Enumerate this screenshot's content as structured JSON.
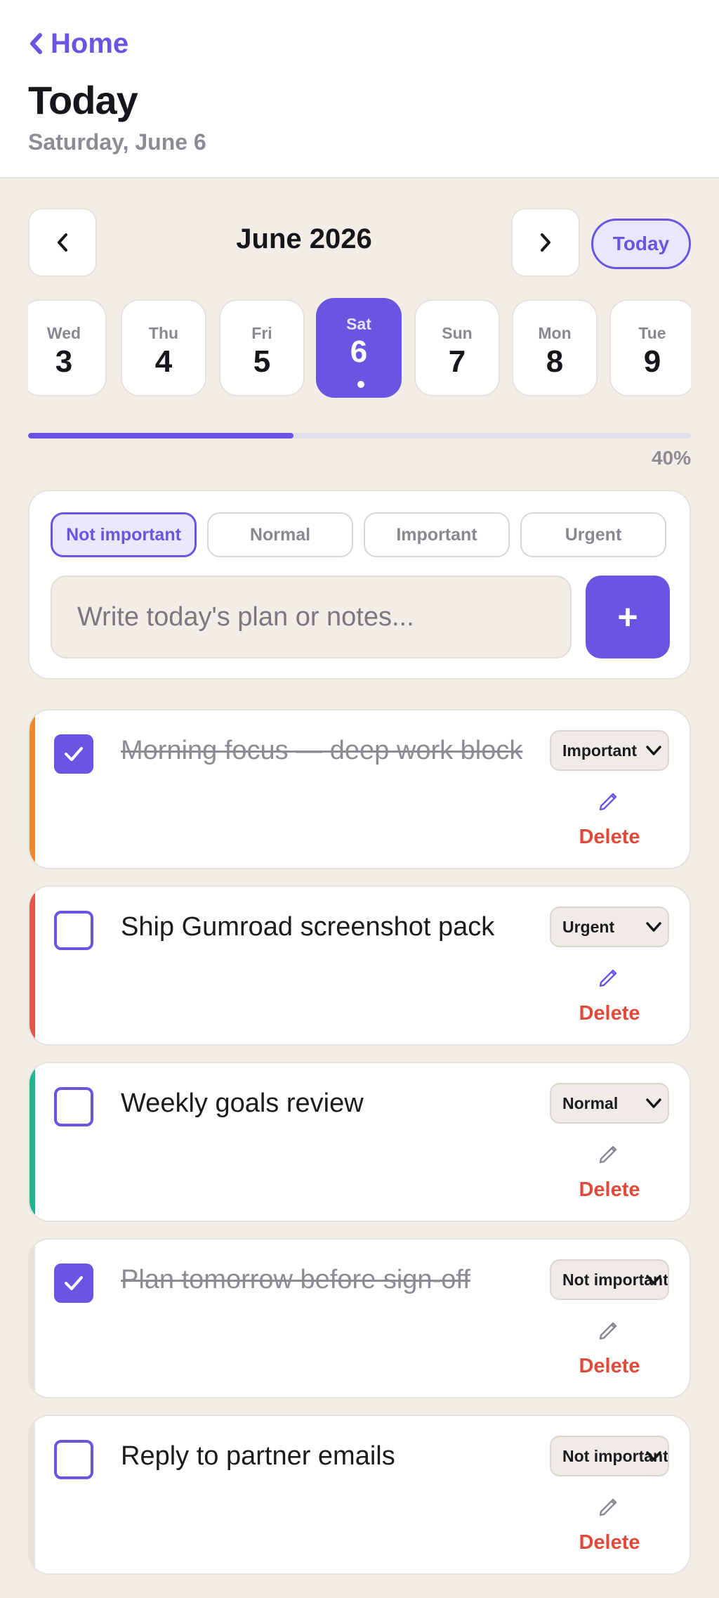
{
  "header": {
    "back_label": "Home",
    "title": "Today",
    "subtitle": "Saturday, June 6"
  },
  "calendar": {
    "month_label": "June 2026",
    "today_label": "Today",
    "prev_icon": "chevron-left-icon",
    "next_icon": "chevron-right-icon",
    "days": [
      {
        "dow": "Wed",
        "num": "3"
      },
      {
        "dow": "Thu",
        "num": "4"
      },
      {
        "dow": "Fri",
        "num": "5"
      },
      {
        "dow": "Sat",
        "num": "6",
        "selected": true,
        "has_dot": true
      },
      {
        "dow": "Sun",
        "num": "7"
      },
      {
        "dow": "Mon",
        "num": "8"
      },
      {
        "dow": "Tue",
        "num": "9"
      }
    ]
  },
  "progress": {
    "value": 0.4,
    "label": "40%"
  },
  "composer": {
    "priorities": [
      "Not important",
      "Normal",
      "Important",
      "Urgent"
    ],
    "active_priority": "Not important",
    "placeholder": "Write today's plan or notes...",
    "add_label": "+"
  },
  "colors": {
    "accent": "#6a55e2",
    "urgent": "#e45746",
    "important": "#ea8a2c",
    "normal": "#1fb58f",
    "not_important": "#e6e2dc",
    "delete": "#e04a3a"
  },
  "tasks": [
    {
      "text": "Morning focus — deep work block",
      "done": true,
      "priority": "Important",
      "edit_icon": "pencil-icon",
      "delete_label": "Delete"
    },
    {
      "text": "Ship Gumroad screenshot pack",
      "done": false,
      "priority": "Urgent",
      "edit_icon": "pencil-icon",
      "delete_label": "Delete"
    },
    {
      "text": "Weekly goals review",
      "done": false,
      "priority": "Normal",
      "edit_icon": "pencil-icon",
      "delete_label": "Delete"
    },
    {
      "text": "Plan tomorrow before sign-off",
      "done": true,
      "priority": "Not important",
      "edit_icon": "pencil-icon",
      "delete_label": "Delete"
    },
    {
      "text": "Reply to partner emails",
      "done": false,
      "priority": "Not important",
      "edit_icon": "pencil-icon",
      "delete_label": "Delete"
    }
  ]
}
